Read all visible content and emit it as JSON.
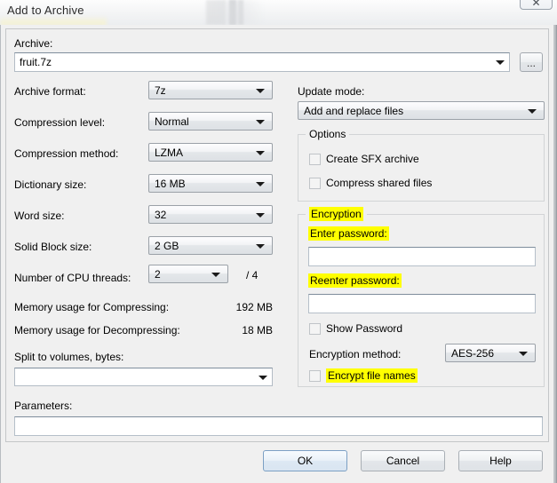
{
  "window": {
    "title": "Add to Archive",
    "close_label": "✕"
  },
  "archive": {
    "label": "Archive:",
    "value": "fruit.7z",
    "placeholder": "",
    "browse_label": "..."
  },
  "left_column": {
    "archive_format": {
      "label": "Archive format:",
      "value": "7z"
    },
    "compression_level": {
      "label": "Compression level:",
      "value": "Normal"
    },
    "compression_method": {
      "label": "Compression method:",
      "value": "LZMA"
    },
    "dictionary_size": {
      "label": "Dictionary size:",
      "value": "16 MB"
    },
    "word_size": {
      "label": "Word size:",
      "value": "32"
    },
    "solid_block_size": {
      "label": "Solid Block size:",
      "value": "2 GB"
    },
    "cpu_threads": {
      "label": "Number of CPU threads:",
      "value": "2",
      "total": "/ 4"
    },
    "memory_compressing": {
      "label": "Memory usage for Compressing:",
      "value": "192 MB"
    },
    "memory_decompressing": {
      "label": "Memory usage for Decompressing:",
      "value": "18 MB"
    },
    "split_volumes": {
      "label": "Split to volumes, bytes:",
      "value": "",
      "placeholder": ""
    },
    "parameters": {
      "label": "Parameters:",
      "value": "",
      "placeholder": ""
    }
  },
  "right_column": {
    "update_mode": {
      "label": "Update mode:",
      "value": "Add and replace files"
    },
    "options": {
      "title": "Options",
      "create_sfx": {
        "label": "Create SFX archive",
        "checked": false
      },
      "compress_shared": {
        "label": "Compress shared files",
        "checked": false
      }
    },
    "encryption": {
      "title": "Encryption",
      "enter_password": {
        "label": "Enter password:",
        "value": "",
        "placeholder": ""
      },
      "reenter_password": {
        "label": "Reenter password:",
        "value": "",
        "placeholder": ""
      },
      "show_password": {
        "label": "Show Password",
        "checked": false
      },
      "encryption_method": {
        "label": "Encryption method:",
        "value": "AES-256"
      },
      "encrypt_file_names": {
        "label": "Encrypt file names",
        "checked": false
      }
    }
  },
  "footer": {
    "ok": "OK",
    "cancel": "Cancel",
    "help": "Help"
  },
  "colors": {
    "dialog_bg": "#f0f0f0",
    "highlight": "#ffff00",
    "default_button_border": "#7ca0c4"
  }
}
